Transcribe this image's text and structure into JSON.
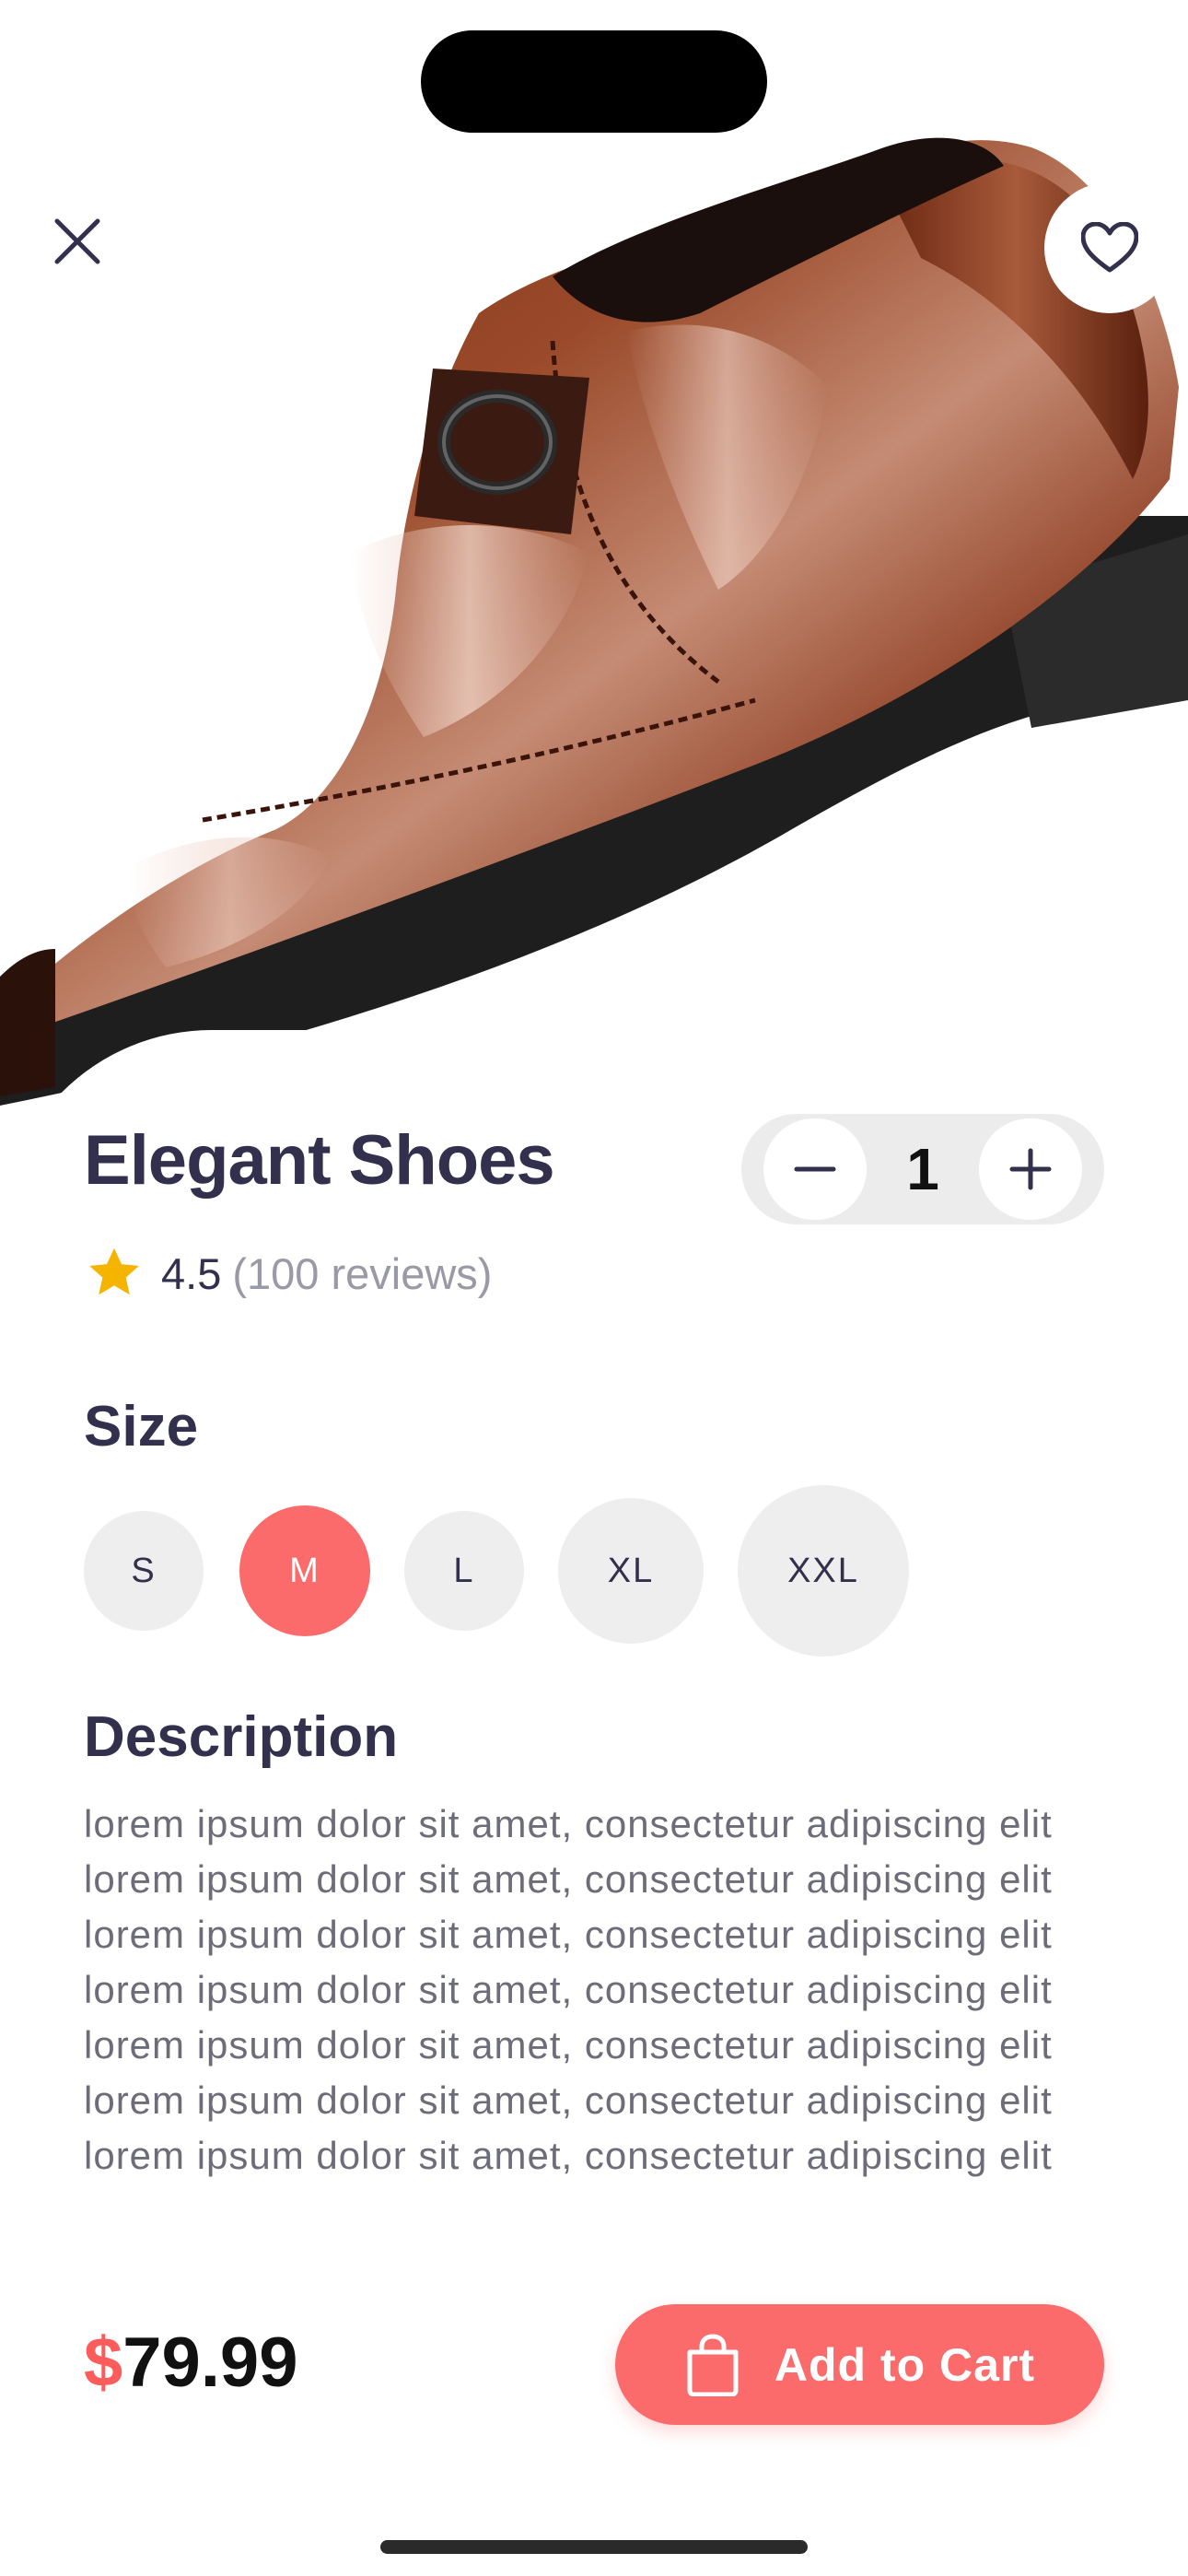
{
  "product": {
    "name": "Elegant Shoes",
    "rating": "4.5",
    "reviews": "(100 reviews)",
    "quantity": "1",
    "price_currency": "$",
    "price_amount": "79.99",
    "favorite": false
  },
  "sections": {
    "size_title": "Size",
    "description_title": "Description"
  },
  "sizes": [
    {
      "label": "S",
      "selected": false
    },
    {
      "label": "M",
      "selected": true
    },
    {
      "label": "L",
      "selected": false
    },
    {
      "label": "XL",
      "selected": false
    },
    {
      "label": "XXL",
      "selected": false
    }
  ],
  "description": "lorem ipsum dolor sit amet, consectetur adipiscing elit lorem ipsum dolor sit amet, consectetur adipiscing elit lorem ipsum dolor sit amet, consectetur adipiscing elit lorem ipsum dolor sit amet, consectetur adipiscing elit lorem ipsum dolor sit amet, consectetur adipiscing elit lorem ipsum dolor sit amet, consectetur adipiscing elit lorem ipsum dolor sit amet, consectetur adipiscing elit",
  "actions": {
    "add_to_cart": "Add to Cart"
  },
  "icons": {
    "close": "close-icon",
    "favorite": "heart-outline-icon",
    "minus": "minus-icon",
    "plus": "plus-icon",
    "star": "star-icon",
    "bag": "shopping-bag-icon"
  },
  "colors": {
    "accent": "#fb6b6b",
    "price_currency": "#fb5d5d",
    "title": "#33304d",
    "star": "#f5b400",
    "chip": "#eeeeee",
    "muted": "#9a99a6"
  }
}
